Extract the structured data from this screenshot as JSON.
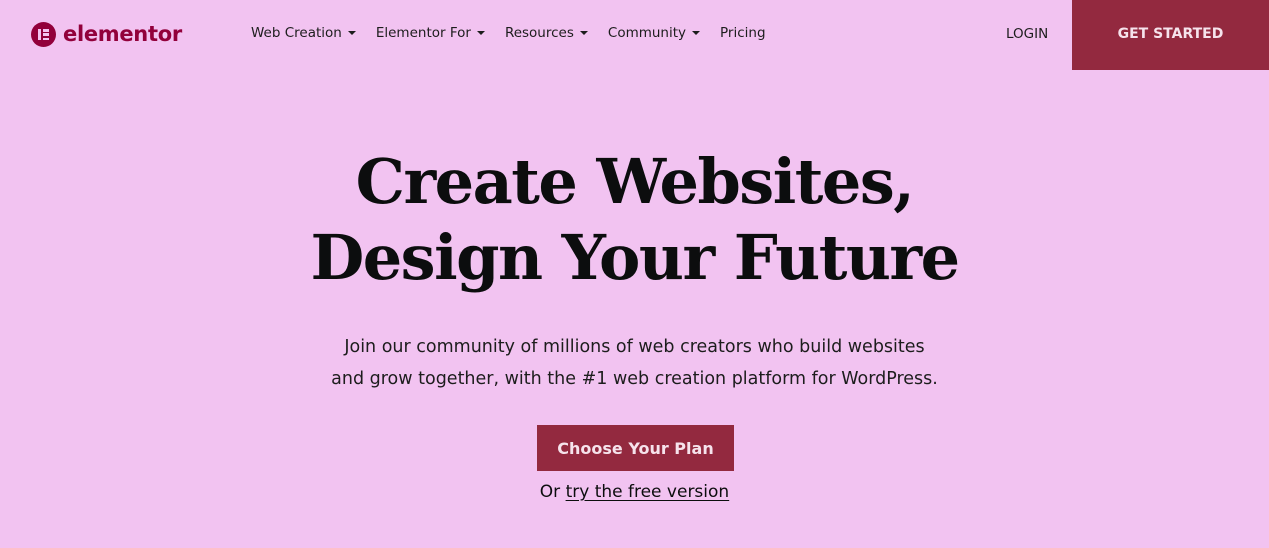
{
  "brand": {
    "name": "elementor",
    "color": "#92003b"
  },
  "nav": {
    "items": [
      {
        "label": "Web Creation",
        "has_dropdown": true
      },
      {
        "label": "Elementor For",
        "has_dropdown": true
      },
      {
        "label": "Resources",
        "has_dropdown": true
      },
      {
        "label": "Community",
        "has_dropdown": true
      },
      {
        "label": "Pricing",
        "has_dropdown": false
      }
    ],
    "login_label": "LOGIN",
    "get_started_label": "GET STARTED"
  },
  "hero": {
    "title_line1": "Create Websites,",
    "title_line2": "Design Your Future",
    "subtitle_line1": "Join our community of millions of web creators who build websites",
    "subtitle_line2": "and grow together, with the #1 web creation platform for WordPress.",
    "cta_label": "Choose Your Plan",
    "free_prefix": "Or",
    "free_link_label": "try the free version"
  },
  "colors": {
    "background": "#f2c3f1",
    "accent": "#93293f",
    "text": "#0c0d0e"
  }
}
